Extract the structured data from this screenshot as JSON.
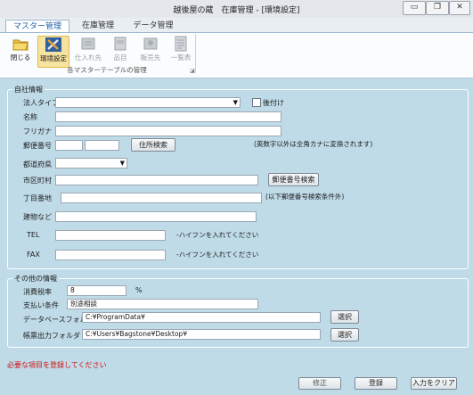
{
  "window": {
    "title": "越後屋の蔵　在庫管理 - [環境設定]",
    "controls": {
      "minimize": "▭",
      "restore": "❐",
      "close": "✕"
    }
  },
  "tabs": [
    "マスター管理",
    "在庫管理",
    "データ管理"
  ],
  "ribbon": {
    "buttons": [
      {
        "label": "閉じる",
        "icon": "folder-close-icon",
        "enabled": true
      },
      {
        "label": "環境設定",
        "icon": "settings-tools-icon",
        "enabled": true
      },
      {
        "label": "仕入れ先",
        "icon": "supplier-icon",
        "enabled": false
      },
      {
        "label": "品目",
        "icon": "item-icon",
        "enabled": false
      },
      {
        "label": "販売先",
        "icon": "customer-icon",
        "enabled": false
      },
      {
        "label": "一覧表",
        "icon": "list-icon",
        "enabled": false
      }
    ],
    "group_caption": "各マスターテーブルの管理"
  },
  "company": {
    "legend": "自社情報",
    "corp_type_label": "法人タイプ",
    "corp_type_value": "",
    "suffix_label": "後付け",
    "name_label": "名称",
    "furigana_label": "フリガナ",
    "postal_label": "郵便番号",
    "address_search_button": "住所検索",
    "kana_note": "(英数字以外は全角カナに変換されます)",
    "prefecture_label": "都道府県",
    "city_label": "市区町村",
    "postal_search_button": "郵便番号検索",
    "street_label": "丁目番地",
    "street_note": "(以下郵便番号検索条件外)",
    "building_label": "建物など",
    "tel_label": "TEL",
    "tel_note": "-ハイフンを入れてください",
    "fax_label": "FAX",
    "fax_note": "-ハイフンを入れてください"
  },
  "other": {
    "legend": "その他の情報",
    "tax_label": "消費税率",
    "tax_value": "8",
    "tax_unit": "%",
    "payment_label": "支払い条件",
    "payment_value": "別途相談",
    "db_folder_label": "データベースフォルダ",
    "db_folder_value": "C:¥ProgramData¥",
    "report_folder_label": "帳票出力フォルダ",
    "report_folder_value": "C:¥Users¥Bagstone¥Desktop¥",
    "browse_button": "選択"
  },
  "footer": {
    "message": "必要な項目を登録してください",
    "message_color": "#d01010",
    "edit_button": "修正",
    "register_button": "登録",
    "clear_button": "入力をクリア"
  }
}
